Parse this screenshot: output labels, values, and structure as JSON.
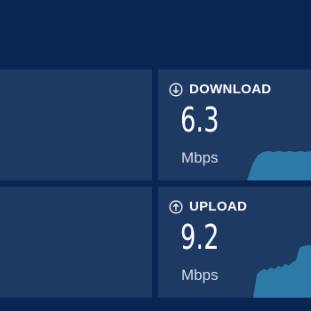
{
  "colors": {
    "background": "#0a2552",
    "panel": "#1e3a63",
    "text": "#ffffff",
    "sparkline": "#2e7aa7"
  },
  "download": {
    "icon": "arrow-down-circle-icon",
    "label": "DOWNLOAD",
    "value": "6.3",
    "unit": "Mbps"
  },
  "upload": {
    "icon": "arrow-up-circle-icon",
    "label": "UPLOAD",
    "value": "9.2",
    "unit": "Mbps"
  }
}
